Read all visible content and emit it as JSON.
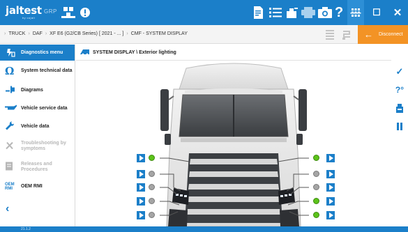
{
  "topbar": {
    "logo": "jaltest",
    "logo_sub": "by cojali",
    "context_label": "GRP"
  },
  "window": {
    "minimize": "—",
    "maximize": "☐",
    "close": "✕"
  },
  "breadcrumb": {
    "items": [
      "TRUCK",
      "DAF",
      "XF E6 (G2/CB Series) [ 2021 - ... ]",
      "CMF - SYSTEM DISPLAY"
    ],
    "separator": "›"
  },
  "disconnect": {
    "label": "Disconnect"
  },
  "sidebar": {
    "header": "Diagnostics menu",
    "items": [
      {
        "label": "System technical data",
        "icon": "omega-icon",
        "enabled": true
      },
      {
        "label": "Diagrams",
        "icon": "plug-icon",
        "enabled": true
      },
      {
        "label": "Vehicle service data",
        "icon": "oilcan-icon",
        "enabled": true
      },
      {
        "label": "Vehicle data",
        "icon": "wrench-icon",
        "enabled": true
      },
      {
        "label": "Troubleshooting by symptoms",
        "icon": "tools-icon",
        "enabled": false
      },
      {
        "label": "Releases and Procedures",
        "icon": "document-icon",
        "enabled": false
      },
      {
        "label": "OEM RMI",
        "icon": "oem-rmi-icon",
        "enabled": true
      }
    ],
    "oem_badge": "OEM RMI"
  },
  "main": {
    "title": "SYSTEM DISPLAY \\ Exterior lighting"
  },
  "status": {
    "version": "21.1.2"
  },
  "lights": {
    "left": [
      {
        "state": "on"
      },
      {
        "state": "off"
      },
      {
        "state": "off"
      },
      {
        "state": "off"
      },
      {
        "state": "off"
      }
    ],
    "right": [
      {
        "state": "on"
      },
      {
        "state": "off"
      },
      {
        "state": "off"
      },
      {
        "state": "on"
      },
      {
        "state": "on"
      }
    ]
  },
  "colors": {
    "brand_blue": "#1b7fc9",
    "accent_orange": "#f39325",
    "led_on": "#5cc31a",
    "led_off": "#a5a5a5"
  }
}
